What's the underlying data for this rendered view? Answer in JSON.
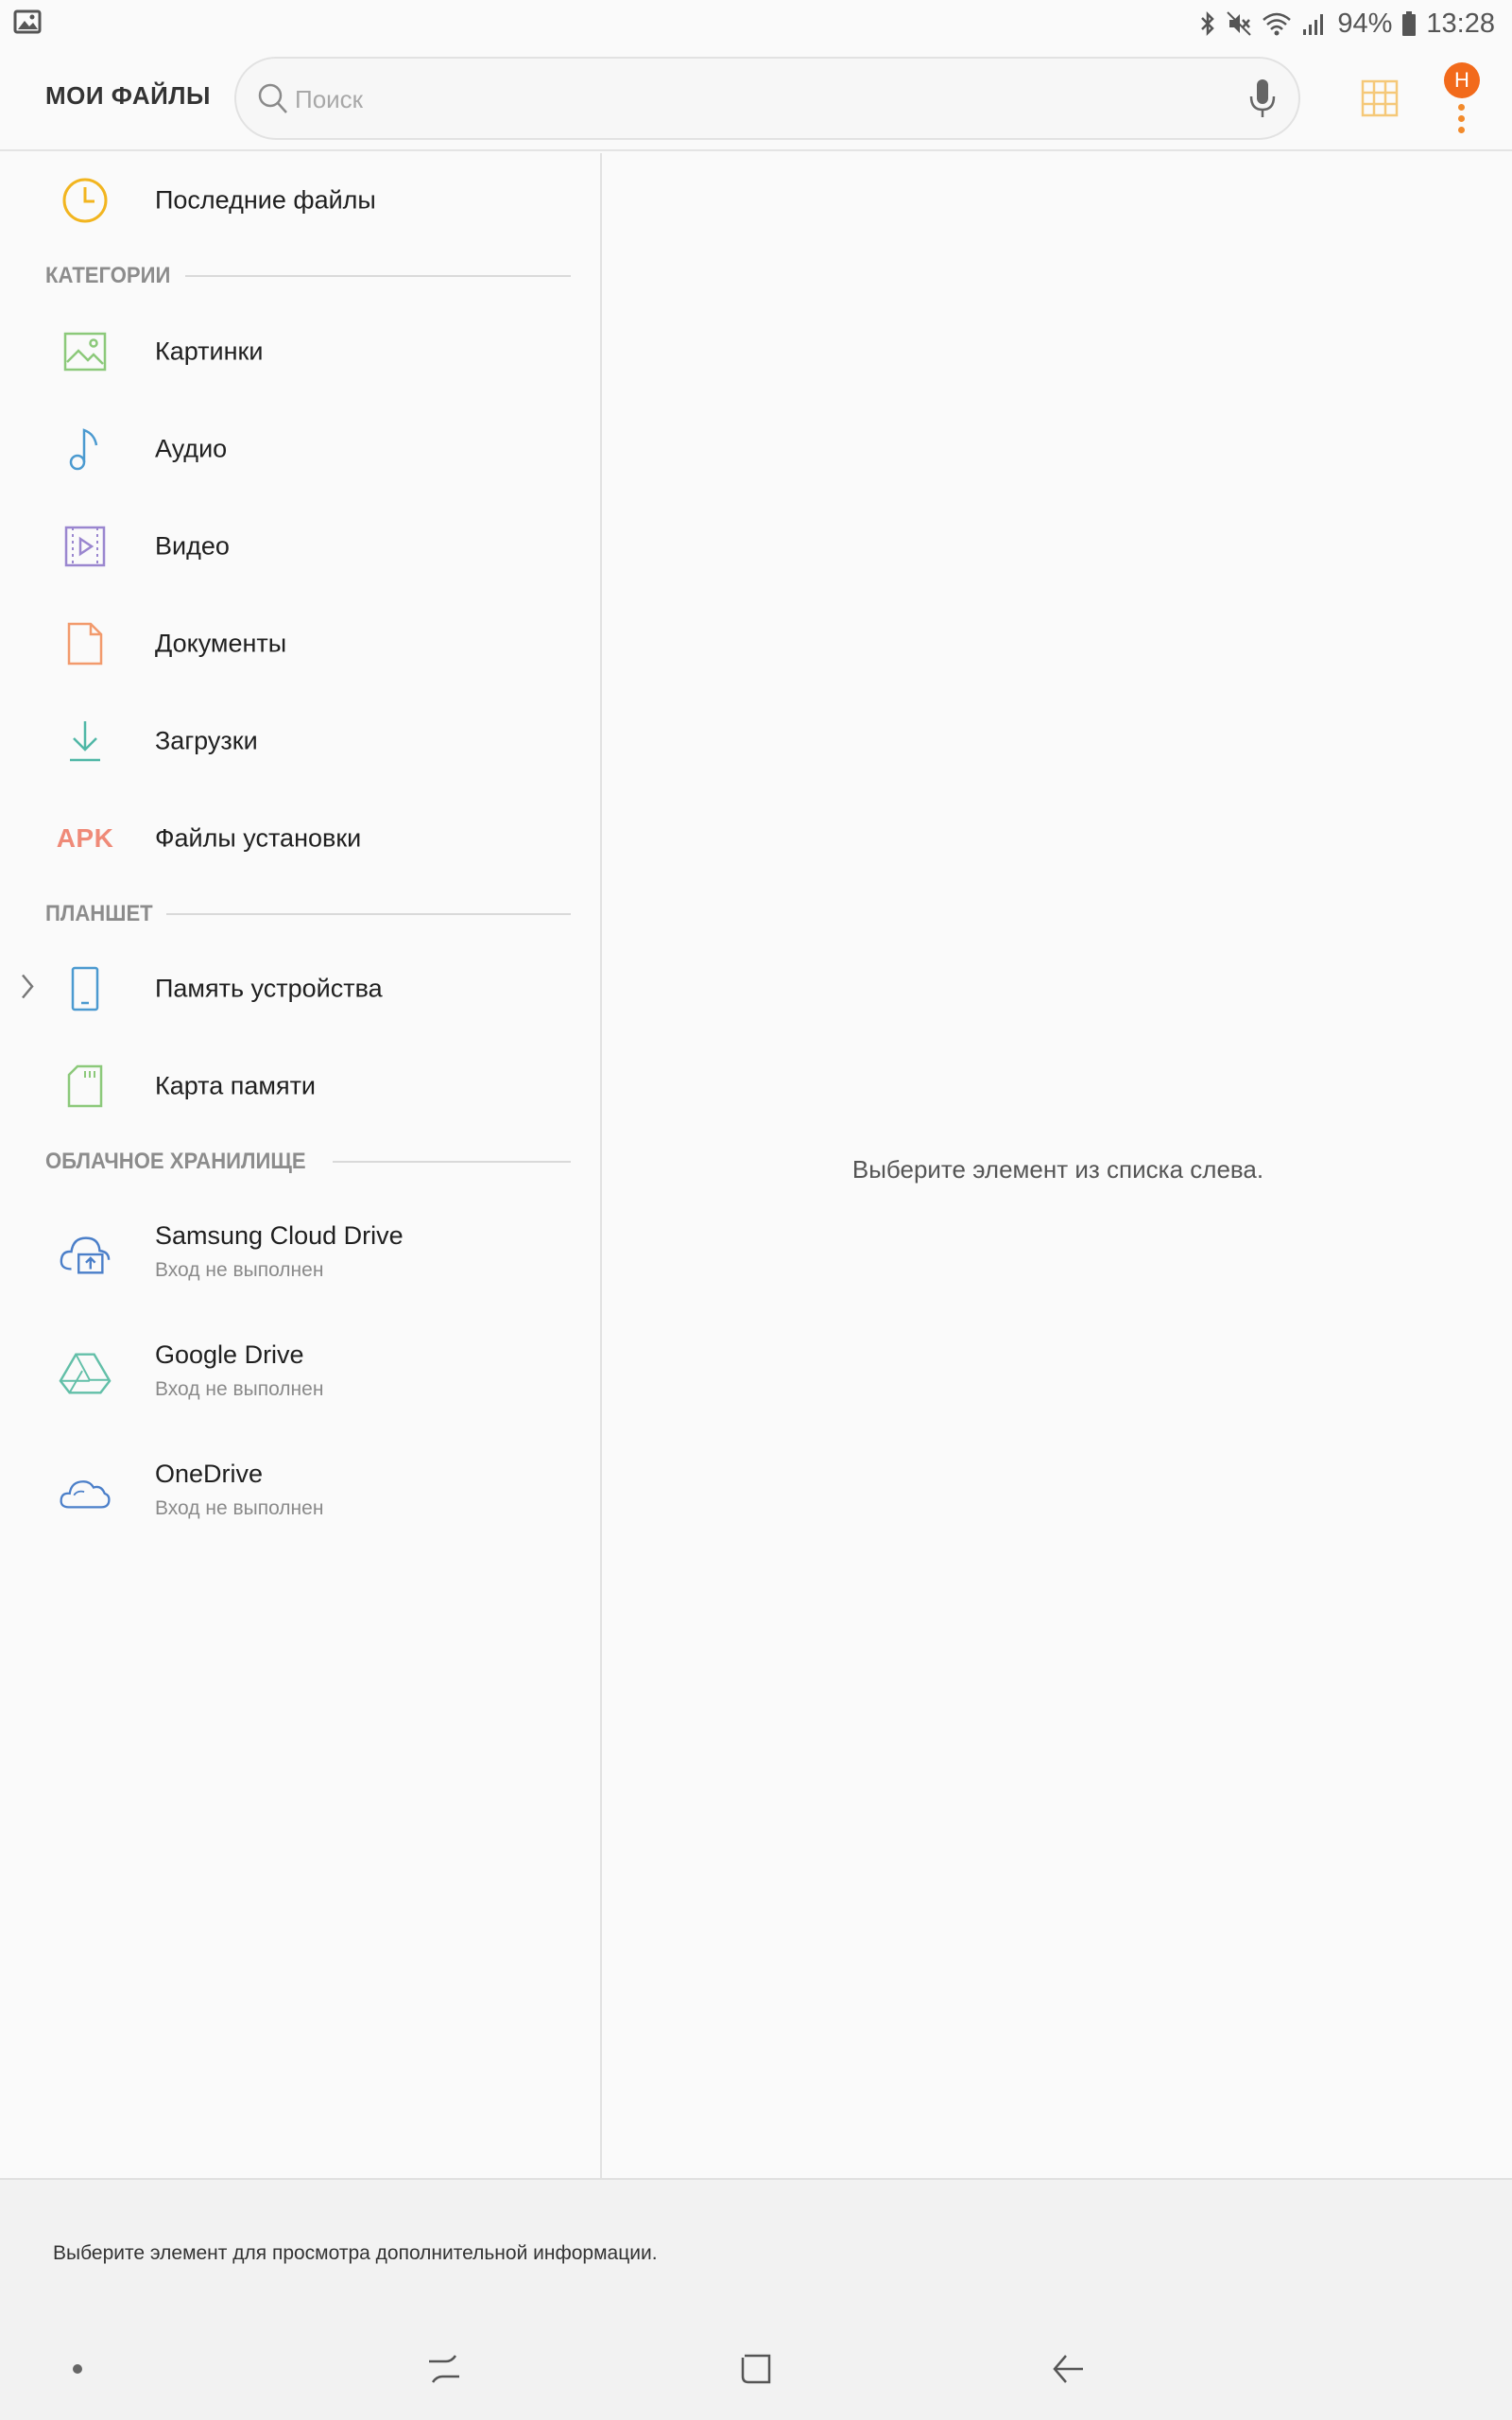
{
  "status_bar": {
    "notification_icon": "gallery-notification-icon",
    "icons": [
      "bluetooth-icon",
      "mute-icon",
      "wifi-icon",
      "signal-icon"
    ],
    "battery": "94%",
    "time": "13:28"
  },
  "header": {
    "title": "МОИ ФАЙЛЫ",
    "search_placeholder": "Поиск",
    "search_icon": "search-icon",
    "mic_icon": "microphone-icon",
    "grid_icon": "grid-view-icon",
    "more_icon": "more-options-icon",
    "badge_letter": "Н",
    "accent": "#f26a1b"
  },
  "recent": {
    "label": "Последние файлы",
    "icon": "clock-icon"
  },
  "categories": {
    "heading": "КАТЕГОРИИ",
    "items": [
      {
        "label": "Картинки",
        "icon": "image-icon"
      },
      {
        "label": "Аудио",
        "icon": "music-note-icon"
      },
      {
        "label": "Видео",
        "icon": "video-icon"
      },
      {
        "label": "Документы",
        "icon": "document-icon"
      },
      {
        "label": "Загрузки",
        "icon": "download-icon"
      },
      {
        "label": "Файлы установки",
        "icon": "apk-icon",
        "icon_text": "APK"
      }
    ]
  },
  "tablet": {
    "heading": "ПЛАНШЕТ",
    "items": [
      {
        "label": "Память устройства",
        "icon": "phone-storage-icon"
      },
      {
        "label": "Карта памяти",
        "icon": "sd-card-icon"
      }
    ]
  },
  "cloud": {
    "heading": "ОБЛАЧНОЕ ХРАНИЛИЩЕ",
    "items": [
      {
        "label": "Samsung Cloud Drive",
        "status": "Вход не выполнен",
        "icon": "samsung-cloud-icon"
      },
      {
        "label": "Google Drive",
        "status": "Вход не выполнен",
        "icon": "google-drive-icon"
      },
      {
        "label": "OneDrive",
        "status": "Вход не выполнен",
        "icon": "onedrive-icon"
      }
    ]
  },
  "main": {
    "empty_message": "Выберите элемент из списка слева."
  },
  "info_bar": {
    "text": "Выберите элемент для просмотра дополнительной информации."
  },
  "nav": {
    "buttons": [
      "dot-icon",
      "recent-apps-icon",
      "home-icon",
      "back-icon"
    ]
  }
}
